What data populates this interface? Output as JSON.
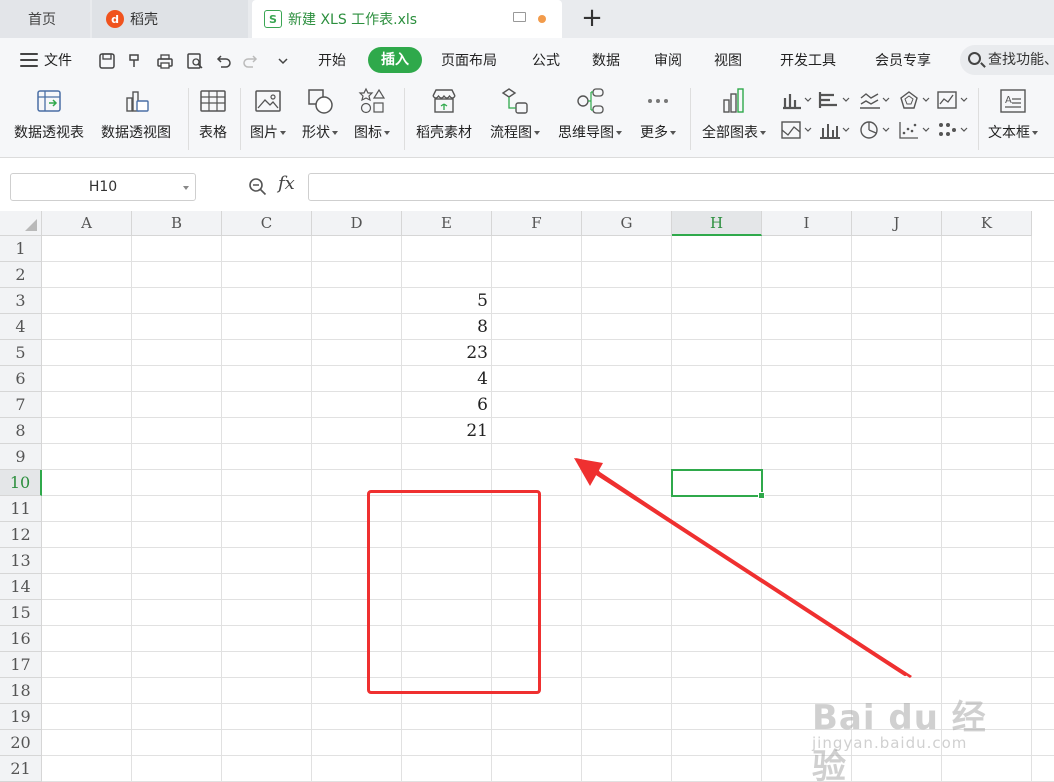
{
  "tabs": {
    "home": "首页",
    "daoke": "稻壳",
    "file": "新建 XLS 工作表.xls",
    "new_tab": "+"
  },
  "menu": {
    "file": "文件",
    "items": [
      "开始",
      "插入",
      "页面布局",
      "公式",
      "数据",
      "审阅",
      "视图",
      "开发工具",
      "会员专享"
    ],
    "active": "插入",
    "search_label": "查找功能、"
  },
  "ribbon": {
    "pivot_table": "数据透视表",
    "pivot_chart": "数据透视图",
    "table": "表格",
    "picture": "图片",
    "shape": "形状",
    "icon": "图标",
    "daoke_material": "稻壳素材",
    "flowchart": "流程图",
    "mindmap": "思维导图",
    "more": "更多",
    "all_charts": "全部图表",
    "textbox": "文本框"
  },
  "formula_bar": {
    "name_box": "H10",
    "fx_label": "fx",
    "formula": ""
  },
  "grid": {
    "columns": [
      "A",
      "B",
      "C",
      "D",
      "E",
      "F",
      "G",
      "H",
      "I",
      "J",
      "K"
    ],
    "rows": [
      "1",
      "2",
      "3",
      "4",
      "5",
      "6",
      "7",
      "8",
      "9",
      "10",
      "11",
      "12",
      "13",
      "14",
      "15",
      "16",
      "17",
      "18",
      "19",
      "20",
      "21"
    ],
    "selected_column": "H",
    "selected_row": "10",
    "column_e_values": [
      {
        "row": "3",
        "value": "5"
      },
      {
        "row": "4",
        "value": "8"
      },
      {
        "row": "5",
        "value": "23"
      },
      {
        "row": "6",
        "value": "4"
      },
      {
        "row": "7",
        "value": "6"
      },
      {
        "row": "8",
        "value": "21"
      }
    ]
  },
  "annotation": {
    "highlight_color": "#ef3030",
    "accent_color": "#2fa94b"
  },
  "watermark": {
    "brand": "Bai du 经验",
    "url": "jingyan.baidu.com"
  }
}
